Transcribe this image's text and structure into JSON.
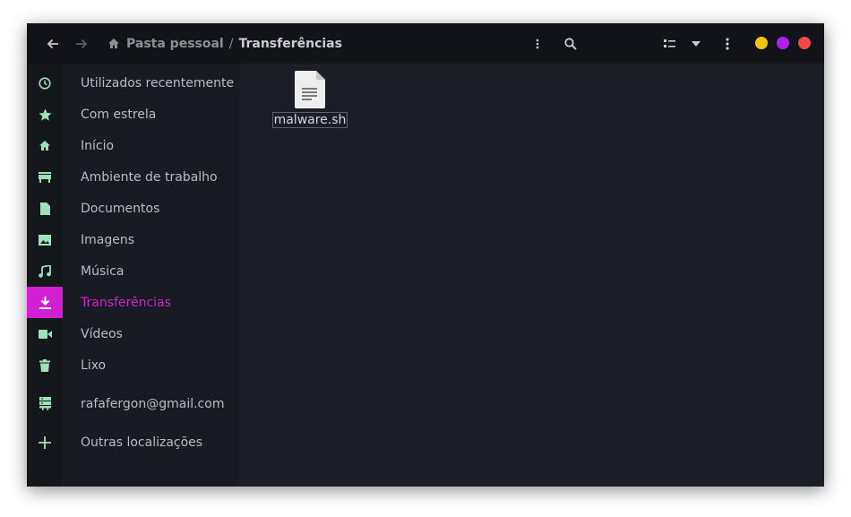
{
  "breadcrumb": {
    "home_label": "Pasta pessoal",
    "separator": "/",
    "current_label": "Transferências"
  },
  "header": {
    "back_icon": "arrow-left-icon",
    "forward_icon": "arrow-right-icon",
    "menu_icon": "vertical-dots-icon",
    "search_icon": "search-icon",
    "view_icon": "list-view-icon",
    "view_dropdown_icon": "caret-down-icon",
    "main_menu_icon": "vertical-dots-icon"
  },
  "window_controls": {
    "minimize_color": "#f5c211",
    "maximize_color": "#b21ff5",
    "close_color": "#f0484d"
  },
  "sidebar": {
    "items": [
      {
        "label": "Utilizados recentemente",
        "icon": "clock-icon"
      },
      {
        "label": "Com estrela",
        "icon": "star-icon"
      },
      {
        "label": "Início",
        "icon": "home-icon"
      },
      {
        "label": "Ambiente de trabalho",
        "icon": "desktop-icon"
      },
      {
        "label": "Documentos",
        "icon": "document-icon"
      },
      {
        "label": "Imagens",
        "icon": "image-icon"
      },
      {
        "label": "Música",
        "icon": "music-icon"
      },
      {
        "label": "Transferências",
        "icon": "download-icon",
        "active": true
      },
      {
        "label": "Vídeos",
        "icon": "video-icon"
      },
      {
        "label": "Lixo",
        "icon": "trash-icon"
      }
    ],
    "account": {
      "label": "rafafergon@gmail.com",
      "icon": "server-icon"
    },
    "other": {
      "label": "Outras localizações",
      "icon": "plus-icon"
    }
  },
  "files": [
    {
      "name": "malware.sh",
      "icon": "text-file-icon"
    }
  ],
  "colors": {
    "accent": "#d21fd3",
    "icon_green": "#9fe0b6"
  }
}
